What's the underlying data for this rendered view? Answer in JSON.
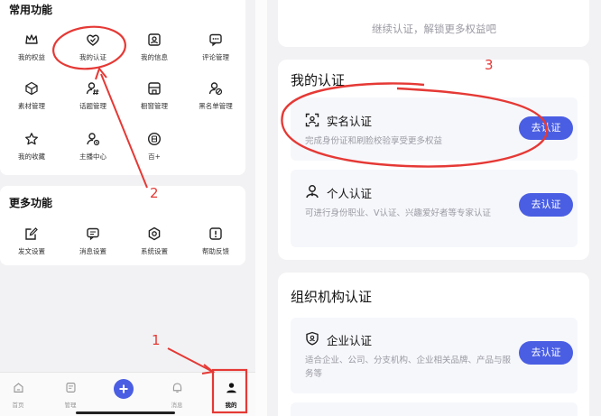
{
  "left": {
    "common_title": "常用功能",
    "common_items": [
      {
        "label": "我的权益",
        "icon": "crown-icon"
      },
      {
        "label": "我的认证",
        "icon": "verified-heart-icon"
      },
      {
        "label": "我的信息",
        "icon": "profile-card-icon"
      },
      {
        "label": "评论管理",
        "icon": "comment-icon"
      },
      {
        "label": "素材管理",
        "icon": "cube-icon"
      },
      {
        "label": "话题管理",
        "icon": "topic-user-icon"
      },
      {
        "label": "橱窗管理",
        "icon": "shop-window-icon"
      },
      {
        "label": "黑名单管理",
        "icon": "blocked-user-icon"
      },
      {
        "label": "我的收藏",
        "icon": "star-icon"
      },
      {
        "label": "主播中心",
        "icon": "anchor-user-icon"
      },
      {
        "label": "百+",
        "icon": "hundred-badge-icon"
      }
    ],
    "more_title": "更多功能",
    "more_items": [
      {
        "label": "发文设置",
        "icon": "edit-icon"
      },
      {
        "label": "消息设置",
        "icon": "message-icon"
      },
      {
        "label": "系统设置",
        "icon": "settings-icon"
      },
      {
        "label": "帮助反馈",
        "icon": "help-icon"
      }
    ],
    "tabbar": [
      {
        "label": "首页",
        "icon": "home-icon"
      },
      {
        "label": "管理",
        "icon": "manage-icon"
      },
      {
        "label": "",
        "icon": "plus-icon"
      },
      {
        "label": "消息",
        "icon": "bell-icon"
      },
      {
        "label": "我的",
        "icon": "user-icon"
      }
    ]
  },
  "annotations": {
    "one": "1",
    "two": "2",
    "three": "3"
  },
  "right": {
    "banner_text": "继续认证，解锁更多权益吧",
    "my_cert_title": "我的认证",
    "certs": [
      {
        "title": "实名认证",
        "desc": "完成身份证和刷脸校验享受更多权益",
        "button": "去认证",
        "icon": "face-scan-icon"
      },
      {
        "title": "个人认证",
        "desc": "可进行身份职业、V认证、兴趣爱好者等专家认证",
        "button": "去认证",
        "icon": "person-icon"
      }
    ],
    "org_title": "组织机构认证",
    "org_certs": [
      {
        "title": "企业认证",
        "desc": "适合企业、公司、分支机构、企业相关品牌、产品与服务等",
        "button": "去认证",
        "icon": "shield-badge-icon"
      }
    ]
  },
  "colors": {
    "accent": "#4a5ee3",
    "annotation": "#e53935"
  }
}
